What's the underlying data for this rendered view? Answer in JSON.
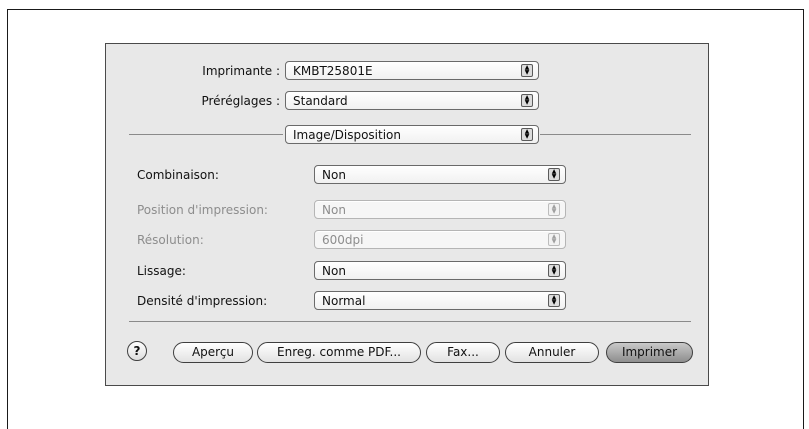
{
  "dialog": {
    "printer": {
      "label": "Imprimante :",
      "value": "KMBT25801E"
    },
    "presets": {
      "label": "Préréglages :",
      "value": "Standard"
    },
    "section": {
      "value": "Image/Disposition"
    },
    "fields": [
      {
        "label": "Combinaison:",
        "value": "Non",
        "enabled": true
      },
      {
        "label": "Position d'impression:",
        "value": "Non",
        "enabled": false
      },
      {
        "label": "Résolution:",
        "value": "600dpi",
        "enabled": false
      },
      {
        "label": "Lissage:",
        "value": "Non",
        "enabled": true
      },
      {
        "label": "Densité d'impression:",
        "value": "Normal",
        "enabled": true
      }
    ],
    "buttons": {
      "help": "?",
      "preview": "Aperçu",
      "save_pdf": "Enreg. comme PDF...",
      "fax": "Fax...",
      "cancel": "Annuler",
      "print": "Imprimer"
    },
    "icons": {
      "popup_arrows": "up-down-arrows-icon",
      "help": "question-mark-icon"
    }
  }
}
